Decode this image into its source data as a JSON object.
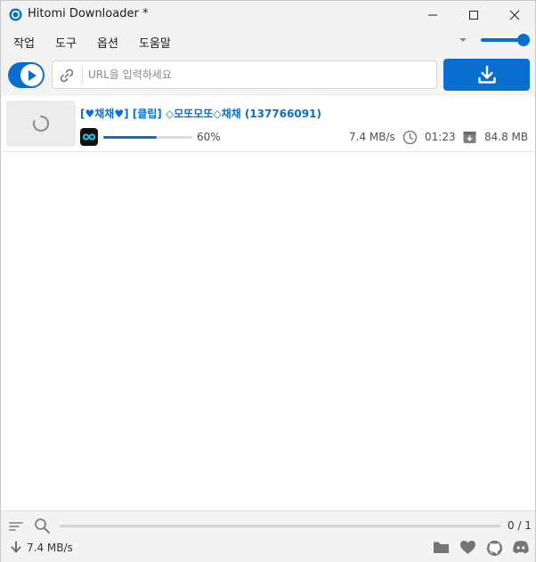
{
  "window": {
    "title": "Hitomi Downloader *"
  },
  "menu": {
    "items": [
      "작업",
      "도구",
      "옵션",
      "도움말"
    ]
  },
  "toolbar": {
    "url_placeholder": "URL을 입력하세요"
  },
  "task": {
    "title": "[♥채채♥] [클립] ◇모또모또◇채채 (137766091)",
    "progress_label": "60%",
    "progress": 0.6,
    "speed": "7.4 MB/s",
    "elapsed": "01:23",
    "size": "84.8 MB"
  },
  "status": {
    "count": "0 / 1",
    "total_speed": "7.4 MB/s"
  },
  "colors": {
    "accent": "#0a6ed1"
  }
}
